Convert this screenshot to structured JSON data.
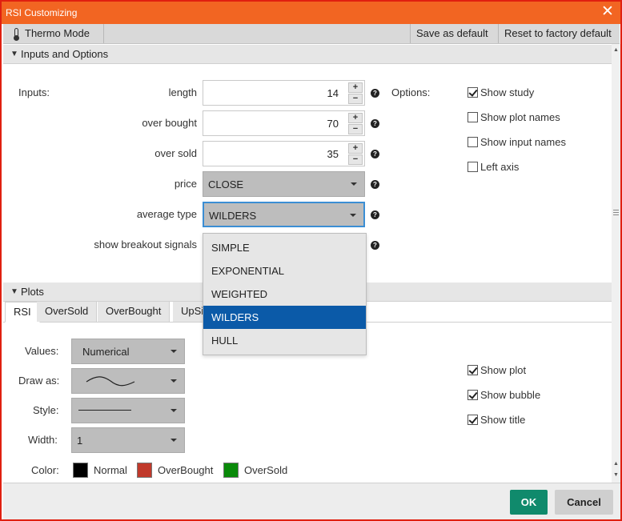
{
  "window": {
    "title": "RSI Customizing",
    "close_glyph": "✕"
  },
  "toolbar": {
    "thermo_label": "Thermo Mode",
    "save_default_label": "Save as default",
    "reset_label": "Reset to factory default"
  },
  "inputs_section": {
    "header": "Inputs and Options",
    "inputs_label": "Inputs:",
    "options_label": "Options:",
    "fields": {
      "length": {
        "label": "length",
        "value": "14"
      },
      "over_bought": {
        "label": "over bought",
        "value": "70"
      },
      "over_sold": {
        "label": "over sold",
        "value": "35"
      },
      "price": {
        "label": "price",
        "value": "CLOSE"
      },
      "average_type": {
        "label": "average type",
        "value": "WILDERS"
      },
      "show_breakout": {
        "label": "show breakout signals"
      }
    },
    "options": [
      {
        "label": "Show study",
        "checked": true
      },
      {
        "label": "Show plot names",
        "checked": false
      },
      {
        "label": "Show input names",
        "checked": false
      },
      {
        "label": "Left axis",
        "checked": false
      }
    ],
    "average_type_options": [
      "SIMPLE",
      "EXPONENTIAL",
      "WEIGHTED",
      "WILDERS",
      "HULL"
    ],
    "average_type_selected": "WILDERS"
  },
  "plots_section": {
    "header": "Plots",
    "tabs": [
      "RSI",
      "OverSold",
      "OverBought",
      "UpSi"
    ],
    "active_tab": "RSI",
    "values_label": "Values:",
    "values_value": "Numerical",
    "draw_as_label": "Draw as:",
    "style_label": "Style:",
    "width_label": "Width:",
    "width_value": "1",
    "color_label": "Color:",
    "colors": [
      {
        "label": "Normal",
        "color": "#000000"
      },
      {
        "label": "OverBought",
        "color": "#c0392b"
      },
      {
        "label": "OverSold",
        "color": "#0a8a0a"
      }
    ],
    "options": [
      {
        "label": "Show plot",
        "checked": true
      },
      {
        "label": "Show bubble",
        "checked": true
      },
      {
        "label": "Show title",
        "checked": true
      }
    ]
  },
  "footer": {
    "ok_label": "OK",
    "cancel_label": "Cancel"
  }
}
